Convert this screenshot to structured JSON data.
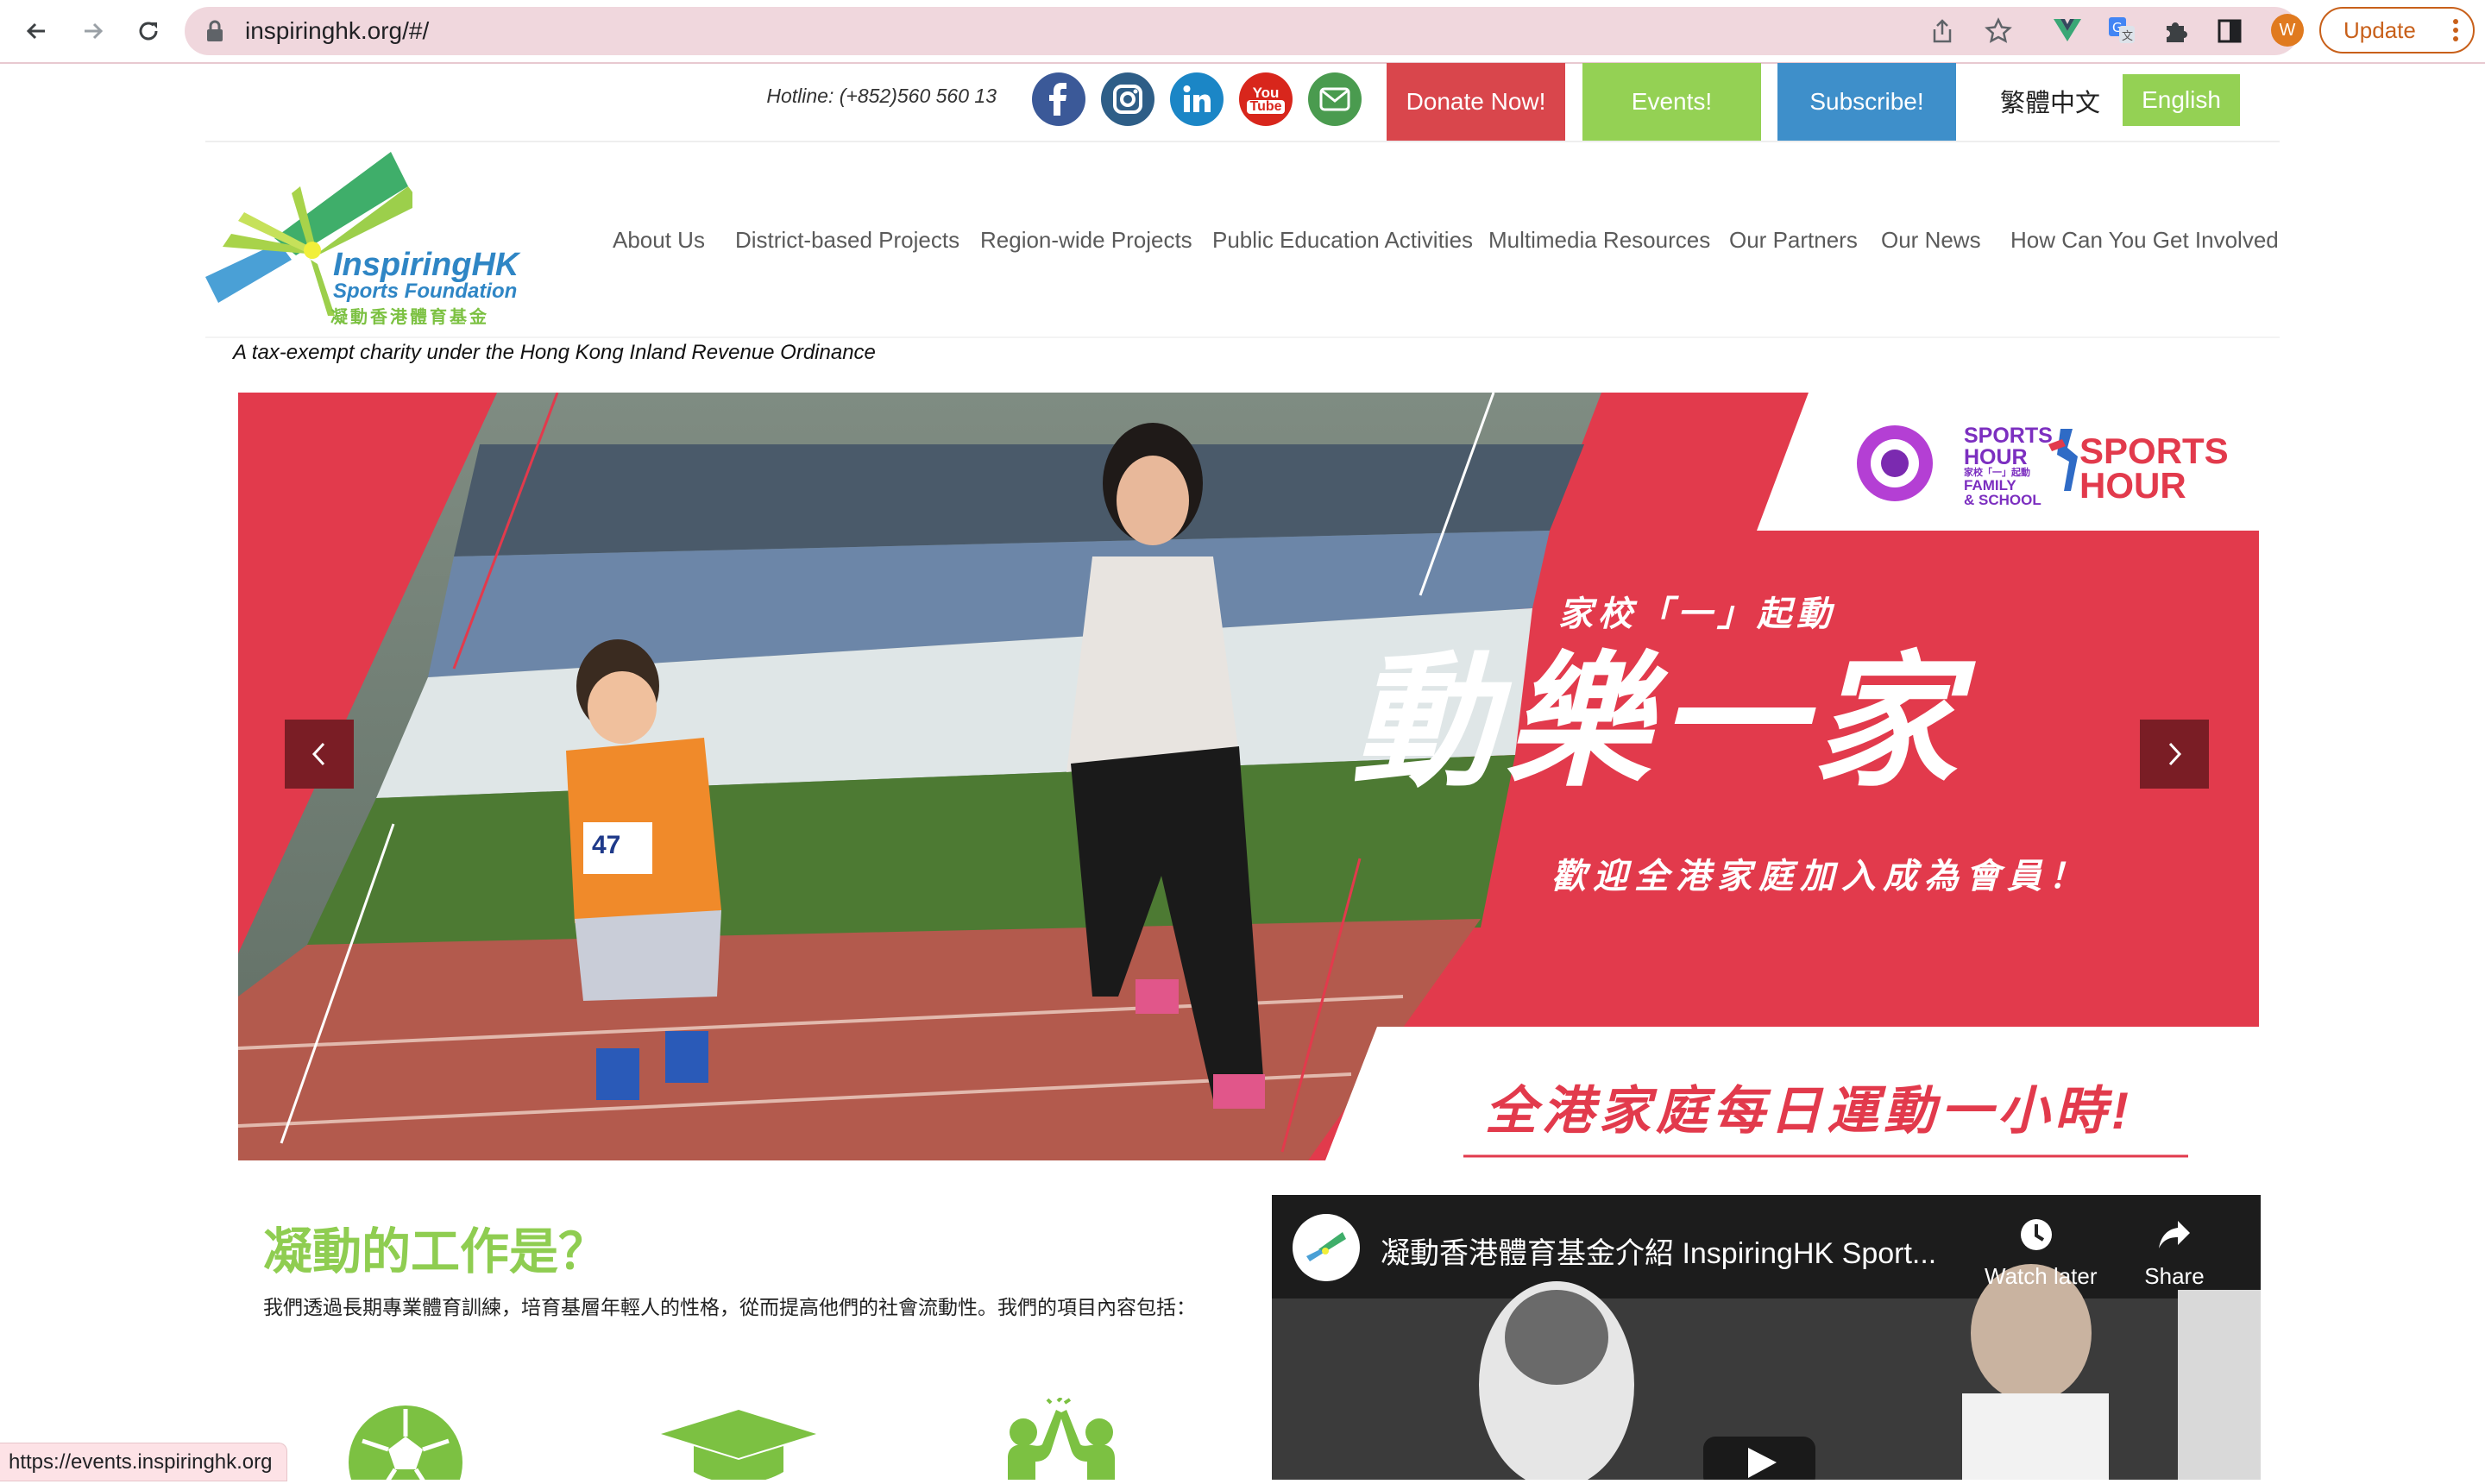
{
  "browser": {
    "url": "inspiringhk.org/#/",
    "update_label": "Update",
    "profile_initial": "W"
  },
  "topbar": {
    "hotline": "Hotline: (+852)560 560 13",
    "social_icons": [
      "facebook-icon",
      "instagram-icon",
      "linkedin-icon",
      "youtube-icon",
      "email-icon"
    ],
    "youtube_text": [
      "You",
      "Tube"
    ],
    "donate_label": "Donate Now!",
    "events_label": "Events!",
    "subscribe_label": "Subscribe!",
    "lang_zh": "繁體中文",
    "lang_en": "English",
    "colors": {
      "donate": "#d9464c",
      "events": "#94d154",
      "subscribe": "#3e8fca"
    }
  },
  "logo": {
    "name": "InspiringHK",
    "subtitle": "Sports Foundation",
    "chinese": "凝動香港體育基金"
  },
  "nav": {
    "items": [
      "About Us",
      "District-based Projects",
      "Region-wide Projects",
      "Public Education Activities",
      "Multimedia Resources",
      "Our Partners",
      "Our News",
      "How Can You Get Involved"
    ]
  },
  "tagline": "A tax-exempt charity under the Hong Kong Inland Revenue Ordinance",
  "hero": {
    "logo1_lines": [
      "SPORTS",
      "HOUR",
      "家校「一」起動",
      "FAMILY",
      "& SCHOOL"
    ],
    "logo2_lines": [
      "SPORTS",
      "HOUR"
    ],
    "subtitle_top": "家校「一」起動",
    "headline": "動樂一家",
    "welcome": "歡迎全港家庭加入成為會員！",
    "bottom_slogan": "全港家庭每日運動一小時!",
    "bib_number": "47",
    "prev_label": "‹",
    "next_label": "›"
  },
  "about": {
    "title": "凝動的工作是？",
    "description": "我們透過長期專業體育訓練，培育基層年輕人的性格，從而提高他們的社會流動性。我們的項目內容包括："
  },
  "video": {
    "title": "凝動香港體育基金介紹 InspiringHK Sport...",
    "watch_later": "Watch later",
    "share": "Share"
  },
  "statusbar": {
    "url": "https://events.inspiringhk.org"
  }
}
